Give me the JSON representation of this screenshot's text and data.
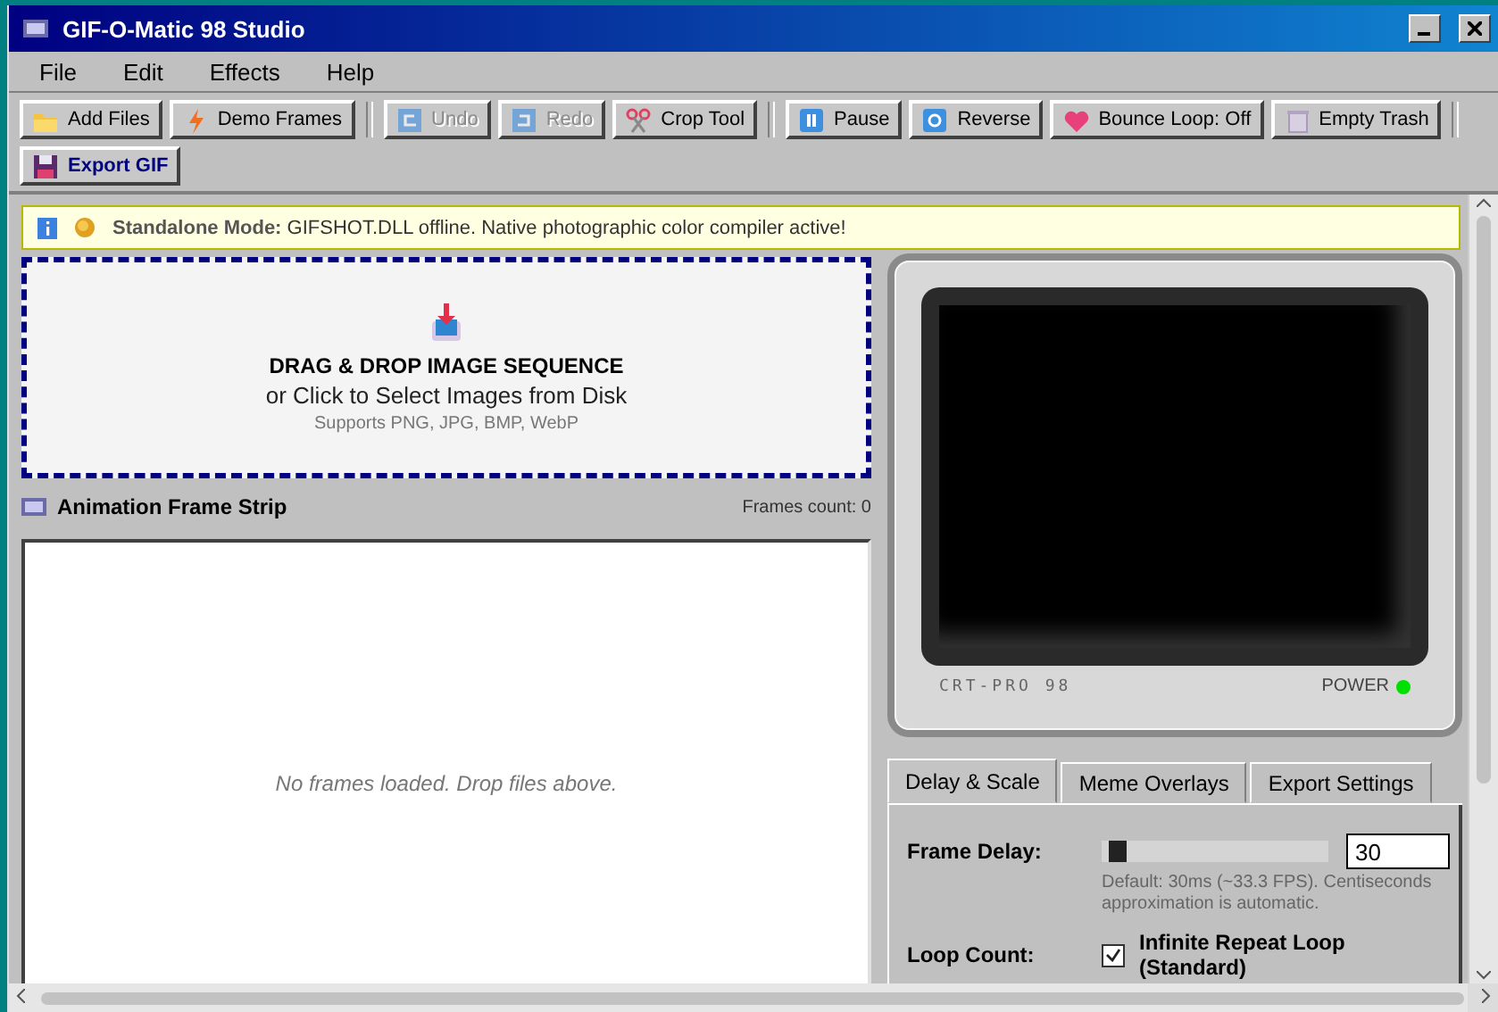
{
  "window": {
    "title": "GIF-O-Matic 98 Studio"
  },
  "menu": [
    "File",
    "Edit",
    "Effects",
    "Help"
  ],
  "toolbar": [
    {
      "kind": "button",
      "label": "Add Files",
      "disabled": false,
      "emphasis": false
    },
    {
      "kind": "button",
      "label": "Demo Frames",
      "disabled": false,
      "emphasis": false
    },
    {
      "kind": "separator"
    },
    {
      "kind": "button",
      "label": "Undo",
      "disabled": true,
      "emphasis": false
    },
    {
      "kind": "button",
      "label": "Redo",
      "disabled": true,
      "emphasis": false
    },
    {
      "kind": "button",
      "label": "Crop Tool",
      "disabled": false,
      "emphasis": false
    },
    {
      "kind": "separator"
    },
    {
      "kind": "button",
      "label": "Pause",
      "disabled": false,
      "emphasis": false
    },
    {
      "kind": "button",
      "label": "Reverse",
      "disabled": false,
      "emphasis": false
    },
    {
      "kind": "button",
      "label": "Bounce Loop: Off",
      "disabled": false,
      "emphasis": false
    },
    {
      "kind": "button",
      "label": "Empty Trash",
      "disabled": false,
      "emphasis": false
    },
    {
      "kind": "separator"
    },
    {
      "kind": "button",
      "label": "Export GIF",
      "disabled": false,
      "emphasis": true
    }
  ],
  "banner": {
    "text": "**Standalone Mode:** GIFSHOT.DLL offline. Native photographic color compiler active!"
  },
  "dropzone": {
    "title": "DRAG & DROP IMAGE SEQUENCE",
    "subtitle": "or Click to Select Images from Disk",
    "hint": "Supports PNG, JPG, BMP, WebP"
  },
  "frame_strip": {
    "title": "Animation Frame Strip",
    "count": "Frames count: 0",
    "empty_message": "No frames loaded. Drop files above."
  },
  "monitor": {
    "brand": "CRT-PRO 98",
    "power_label": "POWER",
    "power_on": true
  },
  "tabs": [
    {
      "label": "Delay & Scale",
      "selected": true
    },
    {
      "label": "Meme Overlays",
      "selected": false
    },
    {
      "label": "Export Settings",
      "selected": false
    }
  ],
  "settings": {
    "frame_delay": {
      "label": "Frame Delay:",
      "level": 0.03,
      "value": "30",
      "hint": "Default: 30ms (~33.3 FPS). Centiseconds approximation is automatic."
    },
    "loop_count": {
      "label": "Loop Count:",
      "checked": true,
      "text": "Infinite Repeat Loop (Standard)"
    }
  }
}
